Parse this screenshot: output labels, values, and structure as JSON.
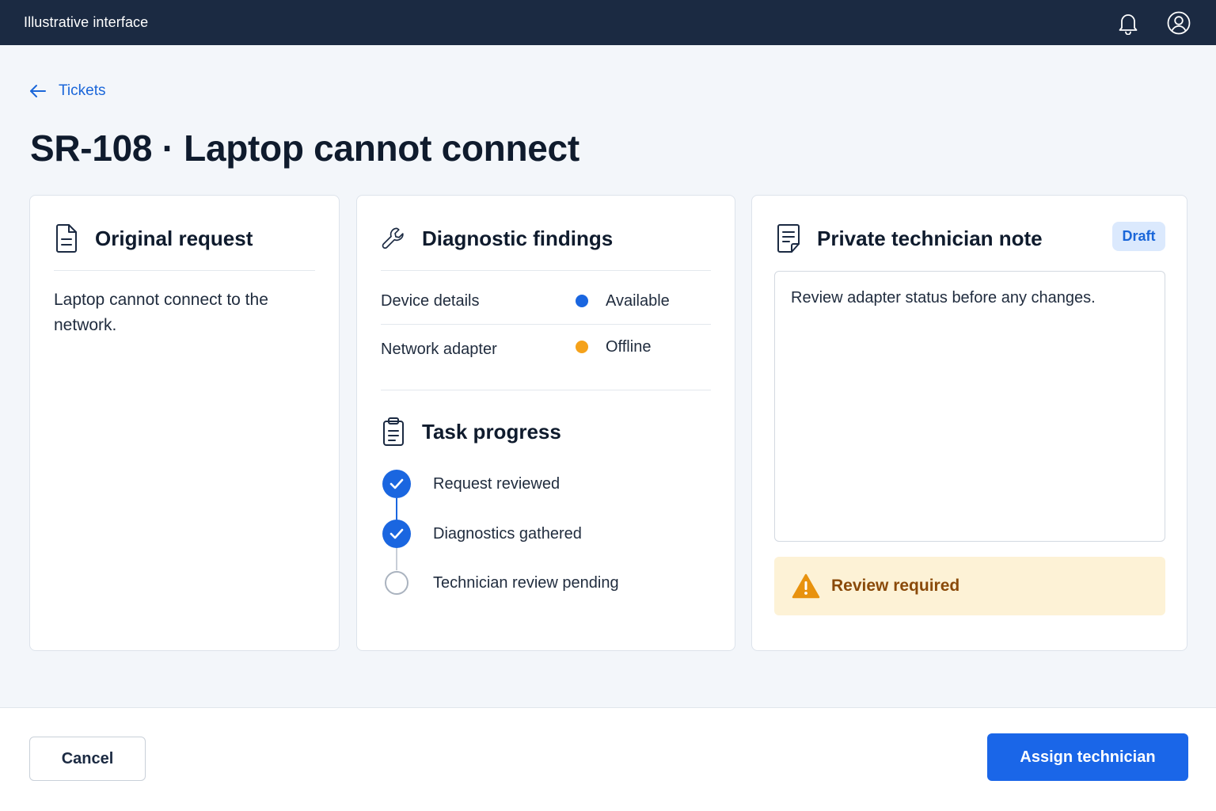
{
  "app": {
    "title": "Illustrative interface"
  },
  "topbar": {
    "icons": [
      "bell-icon",
      "user-circle-icon"
    ]
  },
  "breadcrumb": {
    "label": "Tickets",
    "icon": "arrow-left-icon"
  },
  "page": {
    "title": "SR-108 · Laptop cannot connect"
  },
  "original_request": {
    "icon": "document-icon",
    "title": "Original request",
    "body": "Laptop cannot connect to the network."
  },
  "diagnostics": {
    "icon": "wrench-icon",
    "title": "Diagnostic findings",
    "rows": [
      {
        "label": "Device details",
        "value": "Available",
        "status_color": "#1a66e0"
      },
      {
        "label": "Network adapter",
        "value": "Offline",
        "status_color": "#f5a21b"
      }
    ]
  },
  "task_progress": {
    "icon": "clipboard-icon",
    "title": "Task progress",
    "steps": [
      {
        "label": "Request reviewed",
        "state": "done"
      },
      {
        "label": "Diagnostics gathered",
        "state": "done"
      },
      {
        "label": "Technician review pending",
        "state": "pending"
      }
    ]
  },
  "technician_note": {
    "icon": "note-icon",
    "title": "Private technician note",
    "badge": "Draft",
    "value": "Review adapter status before any changes.",
    "warning": {
      "icon": "warning-icon",
      "text": "Review required"
    }
  },
  "footer": {
    "cancel_label": "Cancel",
    "primary_label": "Assign technician"
  },
  "colors": {
    "topbar": "#1b2a42",
    "accent": "#1a66e8",
    "warning_bg": "#fdf2d6",
    "warning_text": "#8a4a0a"
  }
}
